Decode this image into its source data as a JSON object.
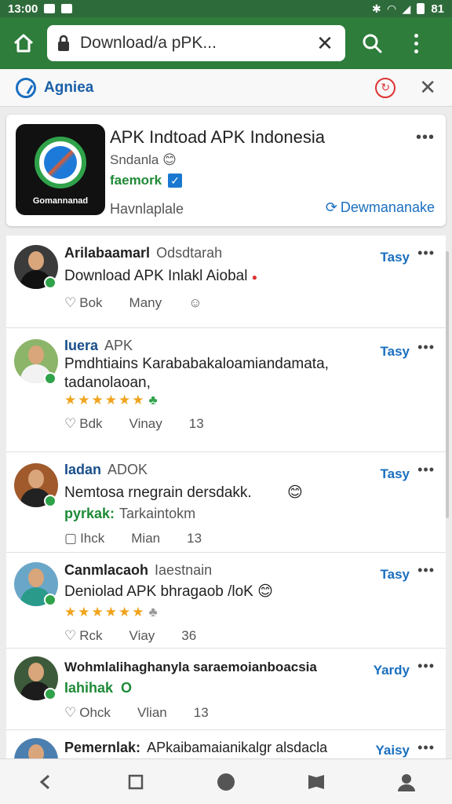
{
  "status_bar": {
    "time": "13:00",
    "battery": "81"
  },
  "browser": {
    "url": "Download/a pPK..."
  },
  "strip": {
    "label": "Agniea"
  },
  "app": {
    "title": "APK Indtoad APK Indonesia",
    "subtitle": "Sndanla",
    "verified_label": "faemork",
    "icon_caption": "Gomannanad",
    "status": "Havnlaplale",
    "download_label": "Dewmananake"
  },
  "comments": [
    {
      "name": "Arilabaamarl",
      "meta": "Odsdtarah",
      "time": "Tasy",
      "text": "Download APK Inlakl Aiobal",
      "actions": [
        "Bok",
        "Many"
      ]
    },
    {
      "name": "Iuera",
      "meta": "APK",
      "time": "Tasy",
      "text": "Pmdhtiains Karababakaloamiandamata, tadanolaoan,",
      "rating": "★★★★★★",
      "actions": [
        "Bdk",
        "Vinay",
        "13"
      ]
    },
    {
      "name": "Iadan",
      "meta": "ADOK",
      "time": "Tasy",
      "text": "Nemtosa rnegrain dersdakk.",
      "sub_green": "pyrkak:",
      "sub_text": "Tarkaintokm",
      "actions": [
        "Ihck",
        "Mian",
        "13"
      ]
    },
    {
      "name": "Canmlacaoh",
      "meta": "Iaestnain",
      "time": "Tasy",
      "text": "Deniolad APK bhragaob /loK",
      "rating": "★★★★★★",
      "actions": [
        "Rck",
        "Viay",
        "36"
      ]
    },
    {
      "name": "Wohmlalihaghanyla saraemoianboacsia",
      "meta": "",
      "time": "Yardy",
      "text": "",
      "sub_green": "Iahihak",
      "sub_text": "O",
      "actions": [
        "Ohck",
        "Vlian",
        "13"
      ]
    },
    {
      "name": "Pemernlak:",
      "meta": "APkaibamaianikalgr alsdacla",
      "time": "Yaisy"
    }
  ]
}
